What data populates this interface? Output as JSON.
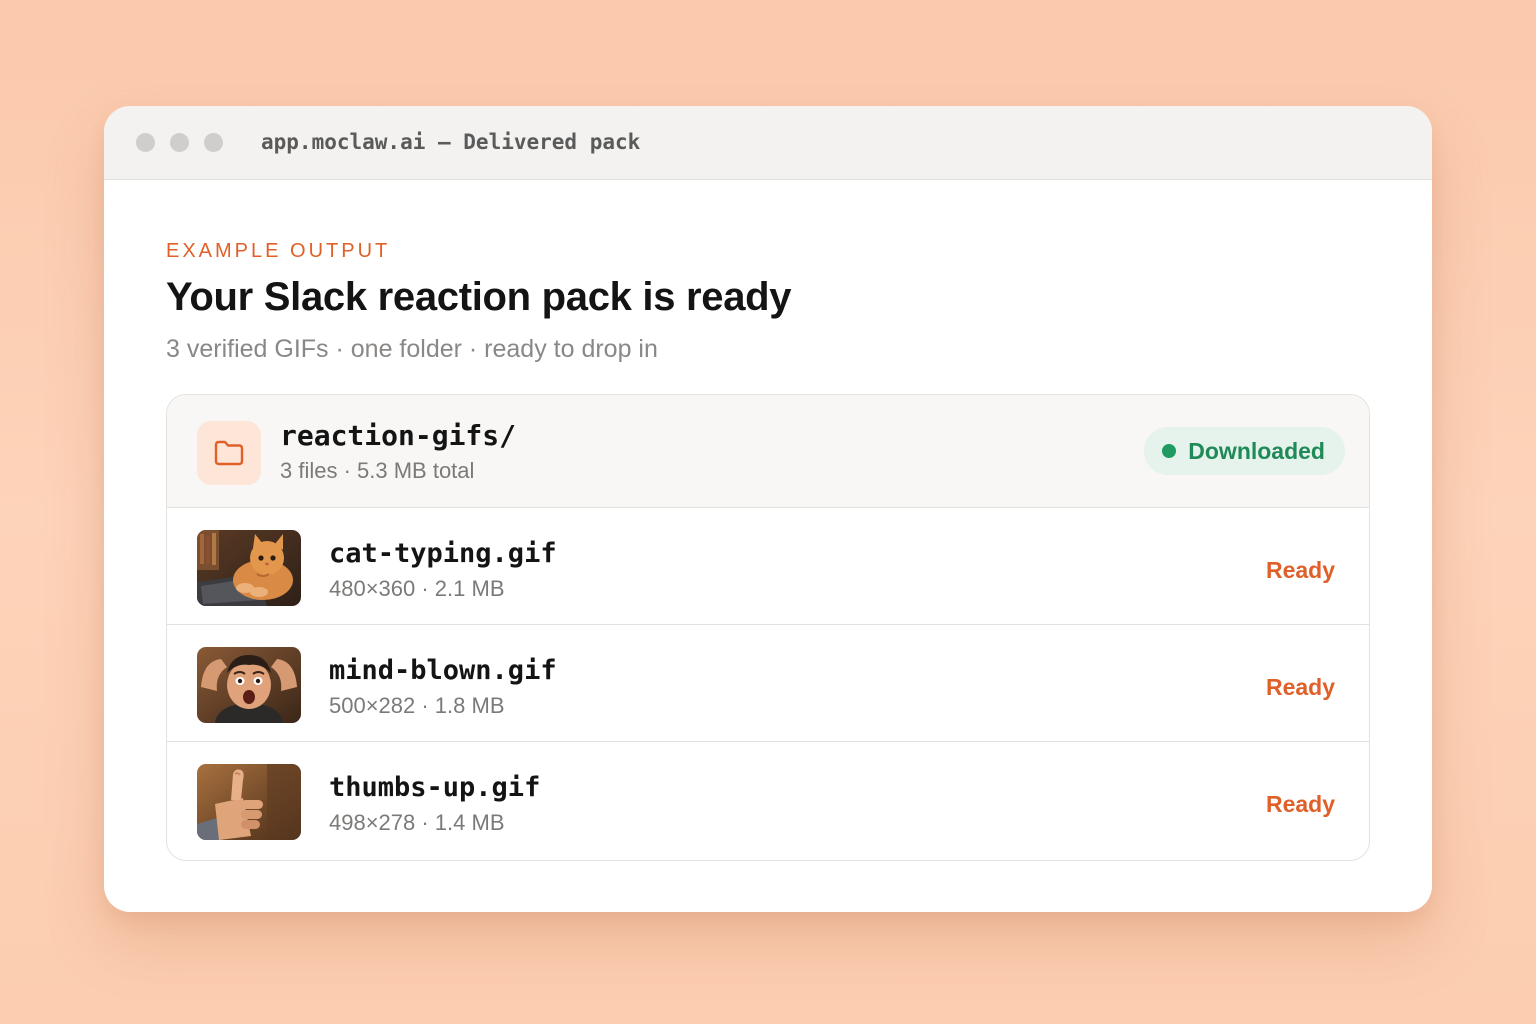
{
  "window": {
    "url_title": "app.moclaw.ai — Delivered pack"
  },
  "hero": {
    "eyebrow": "EXAMPLE OUTPUT",
    "title": "Your Slack reaction pack is ready",
    "subtitle": "3 verified GIFs · one folder · ready to drop in"
  },
  "folder": {
    "icon": "folder-icon",
    "name": "reaction-gifs/",
    "meta": "3 files · 5.3 MB total",
    "status": "Downloaded",
    "status_color": "#1f9a61"
  },
  "files": [
    {
      "name": "cat-typing.gif",
      "meta": "480×360 · 2.1 MB",
      "status": "Ready",
      "thumbnail": "cat-typing-thumbnail"
    },
    {
      "name": "mind-blown.gif",
      "meta": "500×282 · 1.8 MB",
      "status": "Ready",
      "thumbnail": "mind-blown-thumbnail"
    },
    {
      "name": "thumbs-up.gif",
      "meta": "498×278 · 1.4 MB",
      "status": "Ready",
      "thumbnail": "thumbs-up-thumbnail"
    }
  ],
  "colors": {
    "accent": "#e0602a",
    "success": "#1f9a61",
    "background": "#fdd0b4"
  }
}
